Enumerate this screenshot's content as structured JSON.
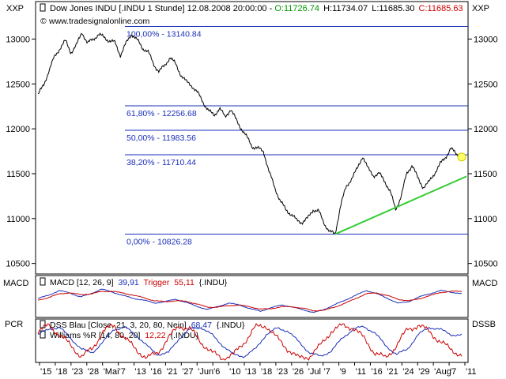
{
  "header": {
    "title": "Dow Jones INDU [.INDU  1 Stunde] 12.08.2008 20:00:00 -",
    "open": "O:11726.74",
    "high": "H:11734.07",
    "low": "L:11685.30",
    "close": "C:11685.63",
    "website": "www.tradesignalonline.com",
    "axis_left_label": "XXP",
    "axis_right_label": "XXP"
  },
  "colors": {
    "price": "#000000",
    "fib": "#1a2fb8",
    "trendline": "#33cc33",
    "marker": "#ffff66",
    "open": "#009900",
    "close": "#cc0000",
    "macd": "#1a2fb8",
    "trigger": "#cc0000",
    "dss": "#1a2fb8",
    "williams": "#cc0000"
  },
  "chart_data": [
    {
      "type": "line",
      "panel": "price",
      "ylim": [
        10400,
        13400
      ],
      "yticks": [
        10500,
        11000,
        11500,
        12000,
        12500,
        13000
      ],
      "xticks": [
        "15",
        "18",
        "23",
        "28",
        "Mai",
        "7",
        "13",
        "16",
        "21",
        "27",
        "Jun",
        "6",
        "10",
        "13",
        "18",
        "23",
        "26",
        "Jul",
        "7",
        "9",
        "11",
        "16",
        "21",
        "24",
        "29",
        "Aug",
        "7",
        "11"
      ],
      "series": [
        {
          "name": "Dow Jones INDU",
          "values": [
            12380,
            12480,
            12650,
            12800,
            12900,
            12980,
            12850,
            12930,
            13080,
            12950,
            13000,
            13050,
            13020,
            12980,
            12960,
            12820,
            12950,
            13060,
            12990,
            12900,
            12860,
            12720,
            12640,
            12700,
            12800,
            12720,
            12600,
            12520,
            12480,
            12400,
            12300,
            12200,
            12150,
            12230,
            12130,
            12220,
            12100,
            12000,
            11900,
            11800,
            11780,
            11750,
            11520,
            11350,
            11200,
            11100,
            11050,
            10980,
            10960,
            11000,
            11100,
            11080,
            10950,
            10850,
            10830,
            11150,
            11350,
            11450,
            11550,
            11700,
            11550,
            11480,
            11500,
            11420,
            11300,
            11100,
            11250,
            11500,
            11600,
            11450,
            11350,
            11400,
            11500,
            11600,
            11680,
            11780,
            11720,
            11686
          ]
        }
      ],
      "fibonacci": [
        {
          "label": "100,00% - 13140.84",
          "value": 13140.84
        },
        {
          "label": "61,80% - 12256.68",
          "value": 12256.68
        },
        {
          "label": "50,00% - 11983.56",
          "value": 11983.56
        },
        {
          "label": "38,20% - 11710.44",
          "value": 11710.44
        },
        {
          "label": "0,00% - 10826.28",
          "value": 10826.28
        }
      ],
      "trendline": {
        "from": 10826.28,
        "to": 11470
      }
    },
    {
      "type": "line",
      "panel": "macd",
      "title": "MACD [12, 26, 9]",
      "label_left": "MACD",
      "label_right": "MACD",
      "series": [
        {
          "name": "MACD",
          "value_label": "39,91",
          "values": [
            10,
            30,
            60,
            45,
            20,
            40,
            70,
            50,
            30,
            10,
            0,
            -20,
            -10,
            5,
            -15,
            -40,
            -60,
            -40,
            -20,
            -30,
            -55,
            -70,
            -50,
            -30,
            -45,
            -60,
            -80,
            -60,
            -30,
            0,
            30,
            60,
            40,
            10,
            -20,
            -10,
            20,
            40,
            60,
            50,
            39.91
          ]
        },
        {
          "name": "Trigger",
          "value_label": "55,11",
          "values": [
            0,
            15,
            40,
            45,
            35,
            38,
            55,
            55,
            45,
            30,
            15,
            -5,
            -10,
            -5,
            -8,
            -25,
            -45,
            -45,
            -35,
            -32,
            -42,
            -58,
            -55,
            -42,
            -43,
            -52,
            -68,
            -65,
            -45,
            -20,
            10,
            40,
            45,
            28,
            5,
            -5,
            8,
            28,
            48,
            55,
            55.11
          ]
        }
      ],
      "source": "{.INDU}"
    },
    {
      "type": "line",
      "panel": "stochastic",
      "ylim": [
        0,
        100
      ],
      "label_left": "PCR",
      "label_right": "DSSB",
      "series": [
        {
          "name": "DSS Blau [Close, 21, 3, 20, 80, Nein]",
          "value_label": "68,47",
          "values": [
            70,
            85,
            90,
            60,
            30,
            20,
            50,
            85,
            90,
            70,
            40,
            15,
            20,
            60,
            85,
            90,
            70,
            40,
            15,
            10,
            30,
            70,
            88,
            80,
            50,
            20,
            10,
            25,
            60,
            85,
            92,
            75,
            40,
            15,
            30,
            70,
            90,
            85,
            70,
            68.47
          ]
        },
        {
          "name": "Williams %R [14, 80, 20]",
          "value_label": "12,22",
          "values": [
            80,
            95,
            70,
            40,
            10,
            30,
            80,
            95,
            60,
            30,
            5,
            20,
            60,
            95,
            85,
            50,
            20,
            5,
            15,
            50,
            90,
            95,
            60,
            30,
            5,
            10,
            40,
            80,
            95,
            90,
            60,
            20,
            5,
            40,
            85,
            95,
            80,
            50,
            30,
            12.22
          ]
        }
      ],
      "source": "{.INDU}"
    }
  ]
}
